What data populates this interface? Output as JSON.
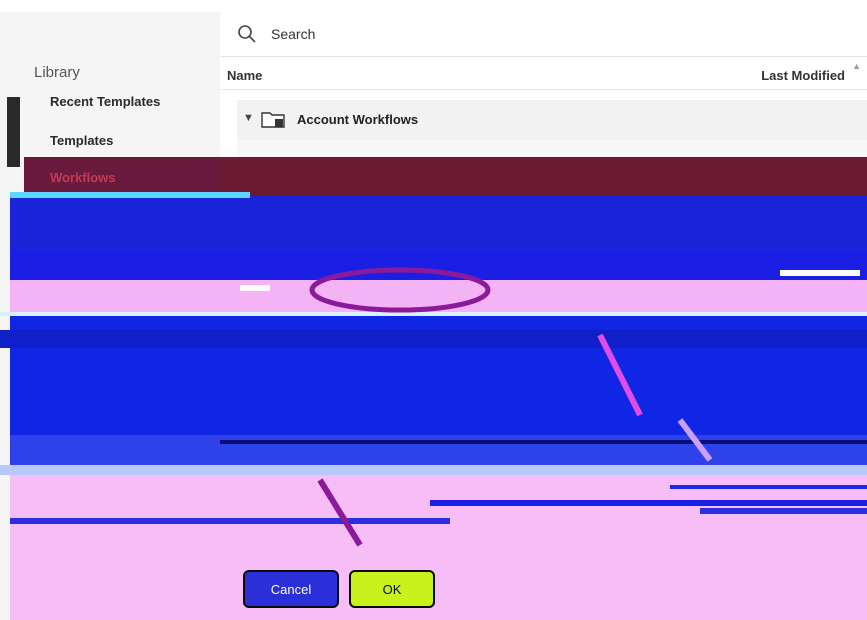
{
  "sidebar": {
    "title": "Library",
    "items": [
      {
        "label": "Recent Templates"
      },
      {
        "label": "Templates"
      },
      {
        "label": "Workflows"
      }
    ]
  },
  "search": {
    "placeholder": "Search"
  },
  "table": {
    "columns": [
      "Name",
      "Last Modified"
    ],
    "folder": {
      "name": "Account Workflows"
    }
  },
  "dialog": {
    "cancel_label": "Cancel",
    "ok_label": "OK"
  },
  "colors": {
    "sidebar_bg": "#f5f5f5",
    "selection_bg": "#6d1a34",
    "accent_red": "#c43a54"
  }
}
